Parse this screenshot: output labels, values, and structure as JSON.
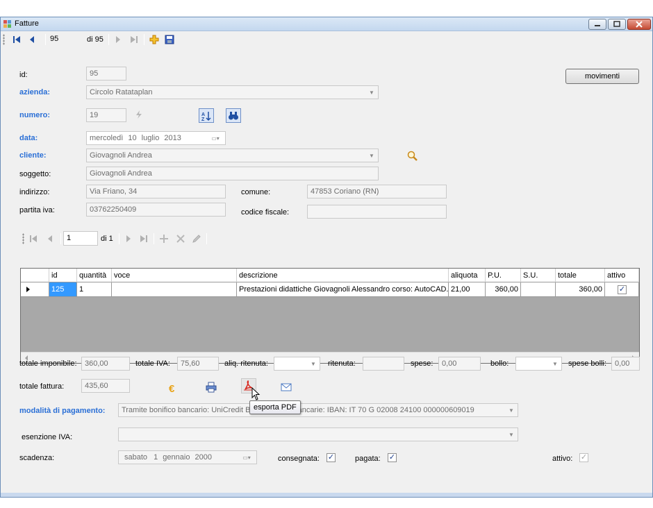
{
  "window": {
    "title": "Fatture"
  },
  "toolbar": {
    "record_position": "95",
    "record_count": "di 95"
  },
  "buttons": {
    "movimenti": "movimenti"
  },
  "labels": {
    "id": "id:",
    "azienda": "azienda:",
    "numero": "numero:",
    "data": "data:",
    "cliente": "cliente:",
    "soggetto": "soggetto:",
    "indirizzo": "indirizzo:",
    "partita_iva": "partita iva:",
    "comune": "comune:",
    "codice_fiscale": "codice fiscale:"
  },
  "fields": {
    "id": "95",
    "azienda": "Circolo Ratataplan",
    "numero": "19",
    "data": {
      "weekday": "mercoledì",
      "day": "10",
      "month": "luglio",
      "year": "2013"
    },
    "cliente": "Giovagnoli Andrea",
    "soggetto": "Giovagnoli Andrea",
    "indirizzo": "Via Friano, 34",
    "comune": "47853 Coriano (RN)",
    "partita_iva": "03762250409",
    "codice_fiscale": ""
  },
  "subnav": {
    "position": "1",
    "count": "di 1"
  },
  "grid": {
    "columns": [
      "id",
      "quantità",
      "voce",
      "descrizione",
      "aliquota",
      "P.U.",
      "S.U.",
      "totale",
      "attivo"
    ],
    "rows": [
      {
        "id": "125",
        "quantita": "1",
        "voce": "",
        "descrizione": "Prestazioni didattiche Giovagnoli Alessandro corso: AutoCAD...",
        "aliquota": "21,00",
        "pu": "360,00",
        "su": "",
        "totale": "360,00",
        "attivo": true
      }
    ]
  },
  "totals": {
    "totale_imponibile_label": "totale imponibile:",
    "totale_imponibile": "360,00",
    "totale_iva_label": "totale IVA:",
    "totale_iva": "75,60",
    "aliq_ritenuta_label": "aliq. ritenuta:",
    "aliq_ritenuta": "",
    "ritenuta_label": "ritenuta:",
    "ritenuta": "",
    "spese_label": "spese:",
    "spese": "0,00",
    "bollo_label": "bollo:",
    "bollo": "",
    "spese_bolli_label": "spese bolli:",
    "spese_bolli": "0,00",
    "totale_fattura_label": "totale fattura:",
    "totale_fattura": "435,60"
  },
  "payment": {
    "modalita_label": "modalità di pagamento:",
    "modalita_value_left": "Tramite bonifico bancario: UniCredit Ba",
    "modalita_value_right": "ancarie: IBAN: IT 70 G 02008 24100 000000609019",
    "esenzione_label": "esenzione IVA:",
    "esenzione_value": "",
    "scadenza_label": "scadenza:",
    "scadenza": {
      "weekday": "sabato",
      "day": "1",
      "month": "gennaio",
      "year": "2000"
    },
    "consegnata_label": "consegnata:",
    "consegnata": true,
    "pagata_label": "pagata:",
    "pagata": true,
    "attivo_label": "attivo:",
    "attivo": true
  },
  "tooltip": "esporta PDF",
  "colors": {
    "accent_label": "#2a6fd6",
    "selection": "#3399ff",
    "euro": "#e8a317"
  }
}
